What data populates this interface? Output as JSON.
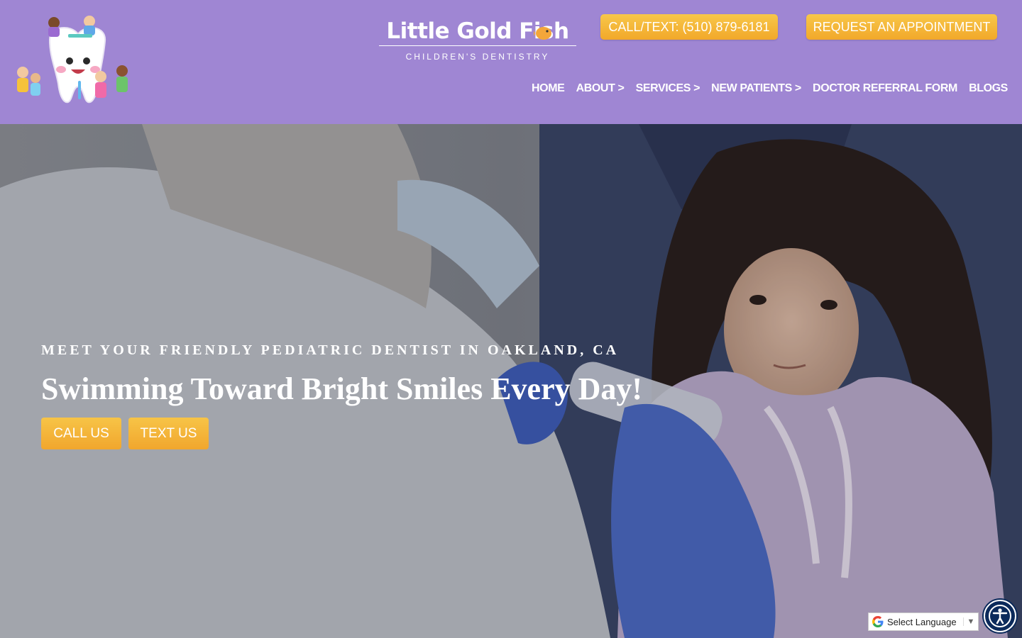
{
  "header": {
    "brand_name": "Little Gold Fish",
    "brand_name_left": "Little Gold Fi",
    "brand_name_right": "sh",
    "brand_tagline": "CHILDREN'S DENTISTRY",
    "call_button": "CALL/TEXT: (510) 879-6181",
    "appointment_button": "REQUEST AN APPOINTMENT",
    "accent_color": "#9f86d3",
    "button_color": "#f4b43a"
  },
  "nav": {
    "items": [
      {
        "label": "HOME"
      },
      {
        "label": "ABOUT >"
      },
      {
        "label": "SERVICES >"
      },
      {
        "label": "NEW PATIENTS >"
      },
      {
        "label": "DOCTOR REFERRAL FORM"
      },
      {
        "label": "BLOGS"
      }
    ]
  },
  "hero": {
    "eyebrow": "MEET YOUR FRIENDLY PEDIATRIC DENTIST IN OAKLAND, CA",
    "title": "Swimming Toward Bright Smiles Every Day!",
    "call_button": "CALL US",
    "text_button": "TEXT US"
  },
  "widgets": {
    "language_label": "Select Language",
    "language_arrow": "▼",
    "accessibility_icon": "accessibility-icon",
    "google_icon": "google-g-icon"
  }
}
